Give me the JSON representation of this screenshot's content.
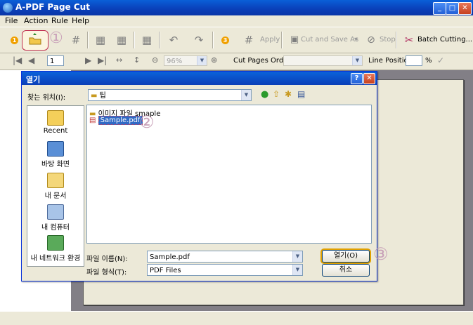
{
  "window": {
    "title": "A-PDF Page Cut",
    "min": "_",
    "max": "□",
    "close": "✕"
  },
  "menu": [
    "File",
    "Action",
    "Rule",
    "Help"
  ],
  "toolbar": {
    "apply_label": "Apply",
    "cut_save_label": "Cut and Save As",
    "stop_label": "Stop",
    "batch_label": "Batch Cutting...",
    "badge_open": "1",
    "badge_apply": "3",
    "annotation_1": "①"
  },
  "toolbar2": {
    "page_value": "1",
    "zoom_value": "96%",
    "cut_order_label": "Cut Pages Order:",
    "line_position_label": "Line Position:",
    "percent": "%"
  },
  "dialog": {
    "title": "열기",
    "help_btn": "?",
    "close_btn": "✕",
    "lookin_label": "찾는 위치(I):",
    "lookin_value": "팁",
    "places": [
      "Recent",
      "바탕 화면",
      "내 문서",
      "내 컴퓨터",
      "내 네트워크 환경"
    ],
    "files": [
      {
        "name": "이미지 파일 smaple",
        "type": "folder"
      },
      {
        "name": "Sample.pdf",
        "type": "pdf",
        "selected": true
      }
    ],
    "annotation_2": "②",
    "annotation_3": "③",
    "filename_label": "파일 이름(N):",
    "filename_value": "Sample.pdf",
    "filetype_label": "파일 형식(T):",
    "filetype_value": "PDF Files",
    "open_btn": "열기(O)",
    "cancel_btn": "취소"
  },
  "colors": {
    "titlebar": "#0a4ccf",
    "accent_red": "#c84060",
    "selection": "#316ac5"
  }
}
